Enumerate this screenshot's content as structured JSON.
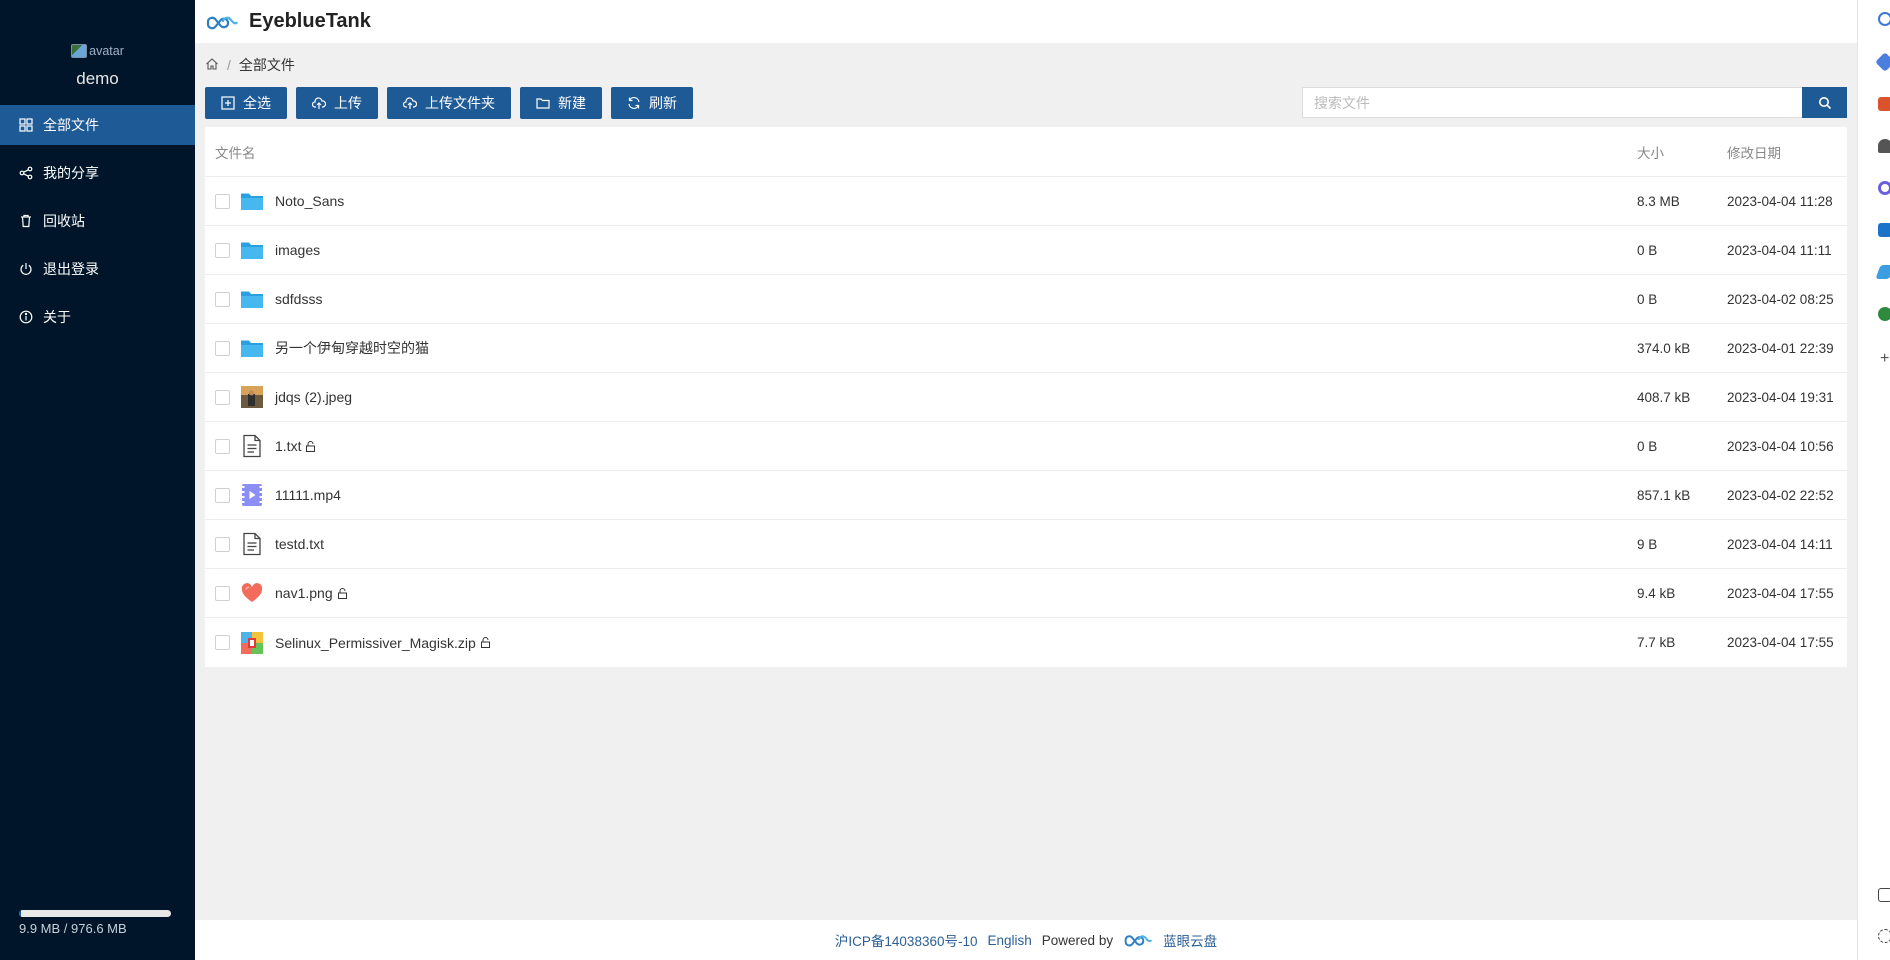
{
  "sidebar": {
    "avatar_alt": "avatar",
    "username": "demo",
    "items": [
      {
        "label": "全部文件",
        "icon": "grid-icon",
        "active": true
      },
      {
        "label": "我的分享",
        "icon": "share-icon",
        "active": false
      },
      {
        "label": "回收站",
        "icon": "trash-icon",
        "active": false
      },
      {
        "label": "退出登录",
        "icon": "power-icon",
        "active": false
      },
      {
        "label": "关于",
        "icon": "info-icon",
        "active": false
      }
    ],
    "storage": {
      "text": "9.9 MB / 976.6 MB",
      "used_fraction": 0.01
    }
  },
  "header": {
    "brand": "EyeblueTank"
  },
  "breadcrumb": {
    "sep": "/",
    "current": "全部文件"
  },
  "toolbar": {
    "select_all": "全选",
    "upload": "上传",
    "upload_folder": "上传文件夹",
    "new": "新建",
    "refresh": "刷新"
  },
  "search": {
    "placeholder": "搜索文件"
  },
  "table": {
    "headers": {
      "name": "文件名",
      "size": "大小",
      "date": "修改日期"
    },
    "rows": [
      {
        "name": "Noto_Sans",
        "type": "folder",
        "size": "8.3 MB",
        "date": "2023-04-04 11:28",
        "locked": false
      },
      {
        "name": "images",
        "type": "folder",
        "size": "0 B",
        "date": "2023-04-04 11:11",
        "locked": false
      },
      {
        "name": "sdfdsss",
        "type": "folder",
        "size": "0 B",
        "date": "2023-04-02 08:25",
        "locked": false
      },
      {
        "name": "另一个伊甸穿越时空的猫",
        "type": "folder",
        "size": "374.0 kB",
        "date": "2023-04-01 22:39",
        "locked": false
      },
      {
        "name": "jdqs (2).jpeg",
        "type": "image",
        "size": "408.7 kB",
        "date": "2023-04-04 19:31",
        "locked": false
      },
      {
        "name": "1.txt",
        "type": "text",
        "size": "0 B",
        "date": "2023-04-04 10:56",
        "locked": true
      },
      {
        "name": "11111.mp4",
        "type": "video",
        "size": "857.1 kB",
        "date": "2023-04-02 22:52",
        "locked": false
      },
      {
        "name": "testd.txt",
        "type": "text",
        "size": "9 B",
        "date": "2023-04-04 14:11",
        "locked": false
      },
      {
        "name": "nav1.png",
        "type": "heart-image",
        "size": "9.4 kB",
        "date": "2023-04-04 17:55",
        "locked": true
      },
      {
        "name": "Selinux_Permissiver_Magisk.zip",
        "type": "zip",
        "size": "7.7 kB",
        "date": "2023-04-04 17:55",
        "locked": true
      }
    ]
  },
  "footer": {
    "icp": "沪ICP备14038360号-10",
    "english": "English",
    "powered_by": "Powered by",
    "product": "蓝眼云盘"
  },
  "colors": {
    "sidebar_bg": "#001529",
    "accent": "#1e5a96",
    "folder": "#2ba0e0"
  }
}
